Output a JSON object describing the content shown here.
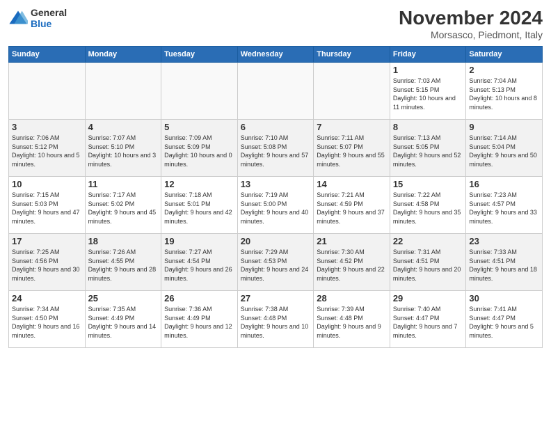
{
  "logo": {
    "line1": "General",
    "line2": "Blue"
  },
  "title": "November 2024",
  "location": "Morsasco, Piedmont, Italy",
  "weekdays": [
    "Sunday",
    "Monday",
    "Tuesday",
    "Wednesday",
    "Thursday",
    "Friday",
    "Saturday"
  ],
  "weeks": [
    [
      {
        "day": "",
        "info": ""
      },
      {
        "day": "",
        "info": ""
      },
      {
        "day": "",
        "info": ""
      },
      {
        "day": "",
        "info": ""
      },
      {
        "day": "",
        "info": ""
      },
      {
        "day": "1",
        "info": "Sunrise: 7:03 AM\nSunset: 5:15 PM\nDaylight: 10 hours and 11 minutes."
      },
      {
        "day": "2",
        "info": "Sunrise: 7:04 AM\nSunset: 5:13 PM\nDaylight: 10 hours and 8 minutes."
      }
    ],
    [
      {
        "day": "3",
        "info": "Sunrise: 7:06 AM\nSunset: 5:12 PM\nDaylight: 10 hours and 5 minutes."
      },
      {
        "day": "4",
        "info": "Sunrise: 7:07 AM\nSunset: 5:10 PM\nDaylight: 10 hours and 3 minutes."
      },
      {
        "day": "5",
        "info": "Sunrise: 7:09 AM\nSunset: 5:09 PM\nDaylight: 10 hours and 0 minutes."
      },
      {
        "day": "6",
        "info": "Sunrise: 7:10 AM\nSunset: 5:08 PM\nDaylight: 9 hours and 57 minutes."
      },
      {
        "day": "7",
        "info": "Sunrise: 7:11 AM\nSunset: 5:07 PM\nDaylight: 9 hours and 55 minutes."
      },
      {
        "day": "8",
        "info": "Sunrise: 7:13 AM\nSunset: 5:05 PM\nDaylight: 9 hours and 52 minutes."
      },
      {
        "day": "9",
        "info": "Sunrise: 7:14 AM\nSunset: 5:04 PM\nDaylight: 9 hours and 50 minutes."
      }
    ],
    [
      {
        "day": "10",
        "info": "Sunrise: 7:15 AM\nSunset: 5:03 PM\nDaylight: 9 hours and 47 minutes."
      },
      {
        "day": "11",
        "info": "Sunrise: 7:17 AM\nSunset: 5:02 PM\nDaylight: 9 hours and 45 minutes."
      },
      {
        "day": "12",
        "info": "Sunrise: 7:18 AM\nSunset: 5:01 PM\nDaylight: 9 hours and 42 minutes."
      },
      {
        "day": "13",
        "info": "Sunrise: 7:19 AM\nSunset: 5:00 PM\nDaylight: 9 hours and 40 minutes."
      },
      {
        "day": "14",
        "info": "Sunrise: 7:21 AM\nSunset: 4:59 PM\nDaylight: 9 hours and 37 minutes."
      },
      {
        "day": "15",
        "info": "Sunrise: 7:22 AM\nSunset: 4:58 PM\nDaylight: 9 hours and 35 minutes."
      },
      {
        "day": "16",
        "info": "Sunrise: 7:23 AM\nSunset: 4:57 PM\nDaylight: 9 hours and 33 minutes."
      }
    ],
    [
      {
        "day": "17",
        "info": "Sunrise: 7:25 AM\nSunset: 4:56 PM\nDaylight: 9 hours and 30 minutes."
      },
      {
        "day": "18",
        "info": "Sunrise: 7:26 AM\nSunset: 4:55 PM\nDaylight: 9 hours and 28 minutes."
      },
      {
        "day": "19",
        "info": "Sunrise: 7:27 AM\nSunset: 4:54 PM\nDaylight: 9 hours and 26 minutes."
      },
      {
        "day": "20",
        "info": "Sunrise: 7:29 AM\nSunset: 4:53 PM\nDaylight: 9 hours and 24 minutes."
      },
      {
        "day": "21",
        "info": "Sunrise: 7:30 AM\nSunset: 4:52 PM\nDaylight: 9 hours and 22 minutes."
      },
      {
        "day": "22",
        "info": "Sunrise: 7:31 AM\nSunset: 4:51 PM\nDaylight: 9 hours and 20 minutes."
      },
      {
        "day": "23",
        "info": "Sunrise: 7:33 AM\nSunset: 4:51 PM\nDaylight: 9 hours and 18 minutes."
      }
    ],
    [
      {
        "day": "24",
        "info": "Sunrise: 7:34 AM\nSunset: 4:50 PM\nDaylight: 9 hours and 16 minutes."
      },
      {
        "day": "25",
        "info": "Sunrise: 7:35 AM\nSunset: 4:49 PM\nDaylight: 9 hours and 14 minutes."
      },
      {
        "day": "26",
        "info": "Sunrise: 7:36 AM\nSunset: 4:49 PM\nDaylight: 9 hours and 12 minutes."
      },
      {
        "day": "27",
        "info": "Sunrise: 7:38 AM\nSunset: 4:48 PM\nDaylight: 9 hours and 10 minutes."
      },
      {
        "day": "28",
        "info": "Sunrise: 7:39 AM\nSunset: 4:48 PM\nDaylight: 9 hours and 9 minutes."
      },
      {
        "day": "29",
        "info": "Sunrise: 7:40 AM\nSunset: 4:47 PM\nDaylight: 9 hours and 7 minutes."
      },
      {
        "day": "30",
        "info": "Sunrise: 7:41 AM\nSunset: 4:47 PM\nDaylight: 9 hours and 5 minutes."
      }
    ]
  ]
}
